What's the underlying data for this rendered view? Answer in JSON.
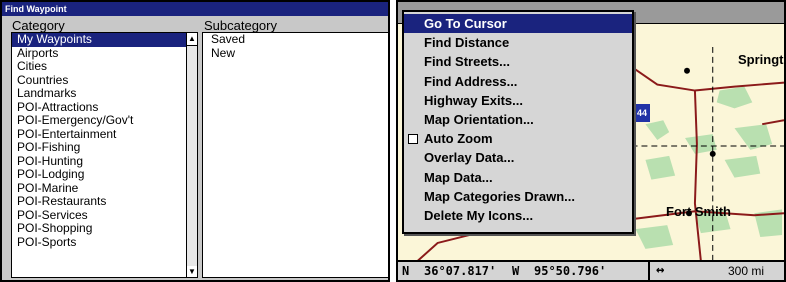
{
  "left_window": {
    "title": "Find Waypoint",
    "category_header": "Category",
    "subcategory_header": "Subcategory",
    "categories": [
      "My Waypoints",
      "Airports",
      "Cities",
      "Countries",
      "Landmarks",
      "POI-Attractions",
      "POI-Emergency/Gov't",
      "POI-Entertainment",
      "POI-Fishing",
      "POI-Hunting",
      "POI-Lodging",
      "POI-Marine",
      "POI-Restaurants",
      "POI-Services",
      "POI-Shopping",
      "POI-Sports"
    ],
    "selected_category": "My Waypoints",
    "subcategories": [
      "Saved",
      "New"
    ]
  },
  "menu": {
    "items": [
      "Go To Cursor",
      "Find Distance",
      "Find Streets...",
      "Find Address...",
      "Highway Exits...",
      "Map Orientation...",
      "Auto Zoom",
      "Overlay Data...",
      "Map Data...",
      "Map Categories Drawn...",
      "Delete My Icons..."
    ],
    "highlighted": "Go To Cursor",
    "auto_zoom_checked": false
  },
  "map": {
    "labels": [
      "Springt",
      "Fort Smith"
    ],
    "highway_shield": "44"
  },
  "status": {
    "lat_hemisphere": "N",
    "latitude": "36°07.817'",
    "lon_hemisphere": "W",
    "longitude": "95°50.796'",
    "scale": "300 mi"
  },
  "colors": {
    "title_bar": "#1a237e",
    "selection": "#1a237e",
    "map_land": "#fbf6d8",
    "map_green": "#b9e0b0",
    "road_red": "#8b1a1a",
    "panel_gray": "#c8c8c8"
  }
}
